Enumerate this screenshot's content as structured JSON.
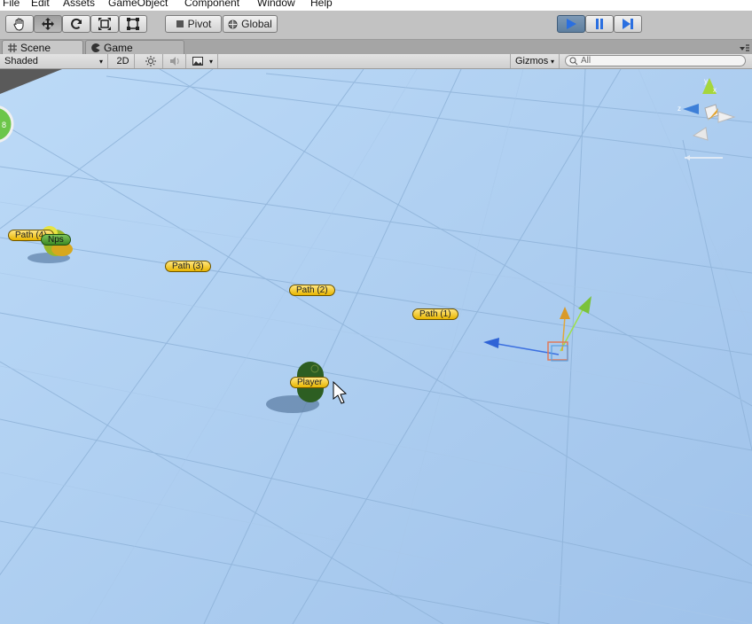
{
  "menu": [
    "File",
    "Edit",
    "Assets",
    "GameObject",
    "Component",
    "Window",
    "Help"
  ],
  "toolbar": {
    "tools": [
      "hand-icon",
      "move-icon",
      "rotate-icon",
      "scale-icon",
      "rect-icon"
    ],
    "pivot_label": "Pivot",
    "global_label": "Global",
    "play": [
      "play-icon",
      "pause-icon",
      "step-icon"
    ]
  },
  "tabs": [
    {
      "label": "Scene",
      "active": true
    },
    {
      "label": "Game",
      "active": false
    }
  ],
  "scenebar": {
    "shading": "Shaded",
    "mode_2d": "2D",
    "gizmos": "Gizmos",
    "search_placeholder": "All"
  },
  "scene": {
    "sky_color": "#b6d5f5",
    "labels": [
      {
        "text": "Path (4)",
        "kind": "path"
      },
      {
        "text": "Nps",
        "kind": "npc"
      },
      {
        "text": "Path (3)",
        "kind": "path"
      },
      {
        "text": "Path (2)",
        "kind": "path"
      },
      {
        "text": "Path (1)",
        "kind": "path"
      },
      {
        "text": "Player",
        "kind": "player"
      }
    ],
    "orientation_gizmo": {
      "axes": [
        "y",
        "z",
        "x"
      ]
    }
  }
}
